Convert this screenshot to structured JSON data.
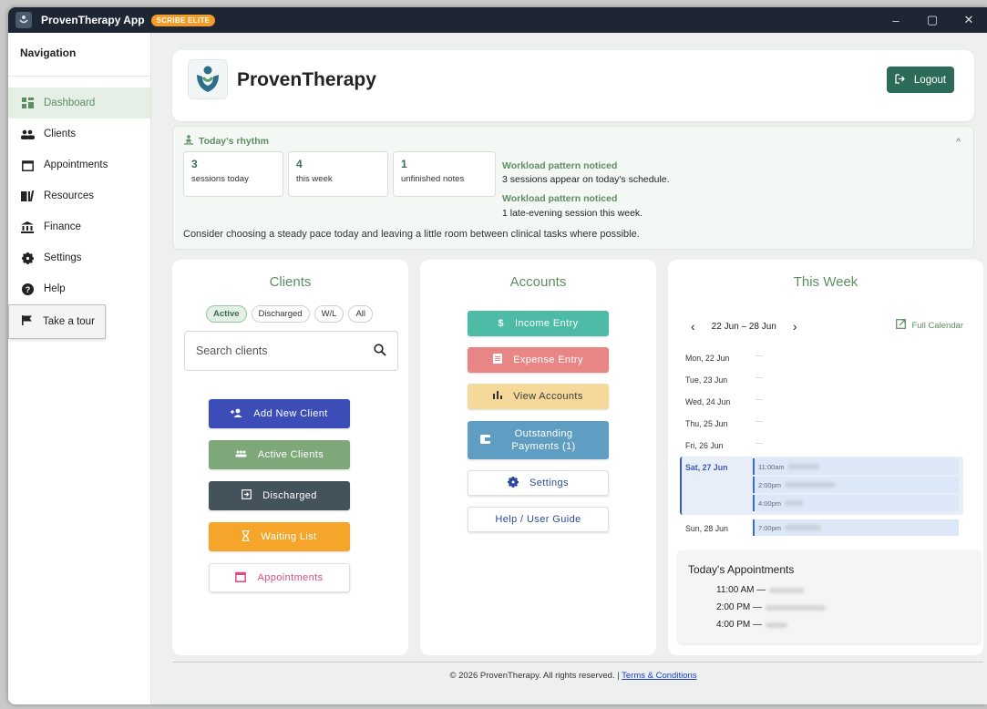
{
  "window": {
    "title": "ProvenTherapy App",
    "badge": "SCRIBE ELITE"
  },
  "sidebar": {
    "title": "Navigation",
    "items": [
      {
        "label": "Dashboard",
        "icon": "dashboard-icon"
      },
      {
        "label": "Clients",
        "icon": "people-icon"
      },
      {
        "label": "Appointments",
        "icon": "calendar-icon"
      },
      {
        "label": "Resources",
        "icon": "book-icon"
      },
      {
        "label": "Finance",
        "icon": "bank-icon"
      },
      {
        "label": "Settings",
        "icon": "gear-icon"
      },
      {
        "label": "Help",
        "icon": "help-icon"
      }
    ],
    "tour": "Take a tour"
  },
  "header": {
    "brand": "ProvenTherapy",
    "logout": "Logout"
  },
  "rhythm": {
    "title": "Today's rhythm",
    "stats": [
      {
        "value": "3",
        "label": "sessions today"
      },
      {
        "value": "4",
        "label": "this week"
      },
      {
        "value": "1",
        "label": "unfinished notes"
      }
    ],
    "notices": [
      {
        "head": "Workload pattern noticed",
        "text": "3 sessions appear on today's schedule."
      },
      {
        "head": "Workload pattern noticed",
        "text": "1 late-evening session this week."
      }
    ],
    "footer": "Consider choosing a steady pace today and leaving a little room between clinical tasks where possible."
  },
  "clients": {
    "title": "Clients",
    "filters": [
      "Active",
      "Discharged",
      "W/L",
      "All"
    ],
    "search_placeholder": "Search clients",
    "buttons": {
      "add": "Add New Client",
      "active": "Active Clients",
      "discharged": "Discharged",
      "waiting": "Waiting List",
      "appointments": "Appointments"
    }
  },
  "accounts": {
    "title": "Accounts",
    "buttons": {
      "income": "Income Entry",
      "expense": "Expense Entry",
      "view": "View Accounts",
      "outstanding_1": "Outstanding",
      "outstanding_2": "Payments (1)",
      "settings": "Settings",
      "guide": "Help / User Guide"
    }
  },
  "week": {
    "title": "This Week",
    "range": "22 Jun – 28 Jun",
    "full_calendar": "Full Calendar",
    "days": [
      "Mon, 22 Jun",
      "Tue, 23 Jun",
      "Wed, 24 Jun",
      "Thu, 25 Jun",
      "Fri, 26 Jun",
      "Sat, 27 Jun",
      "Sun, 28 Jun"
    ],
    "empty": "—",
    "sat_appts": [
      "11:00am",
      "2:00pm",
      "4:00pm"
    ],
    "sun_appts": [
      "7:00pm"
    ],
    "today_title": "Today's Appointments",
    "today": [
      "11:00 AM —",
      "2:00 PM —",
      "4:00 PM —"
    ]
  },
  "footer": {
    "text": "© 2026 ProvenTherapy. All rights reserved. |",
    "link": "Terms & Conditions"
  },
  "colors": {
    "accent_green": "#5e8d64",
    "logout": "#2c6b58",
    "add_client": "#3d4db7",
    "active_clients": "#7fa87a",
    "discharged": "#44525c",
    "waiting": "#f5a52a",
    "pink": "#e14b82",
    "income": "#4dbba6",
    "expense": "#e88585",
    "view_accounts": "#f5d99a",
    "outstanding": "#5f9dc2",
    "settings_blue": "#2c4a9d"
  }
}
